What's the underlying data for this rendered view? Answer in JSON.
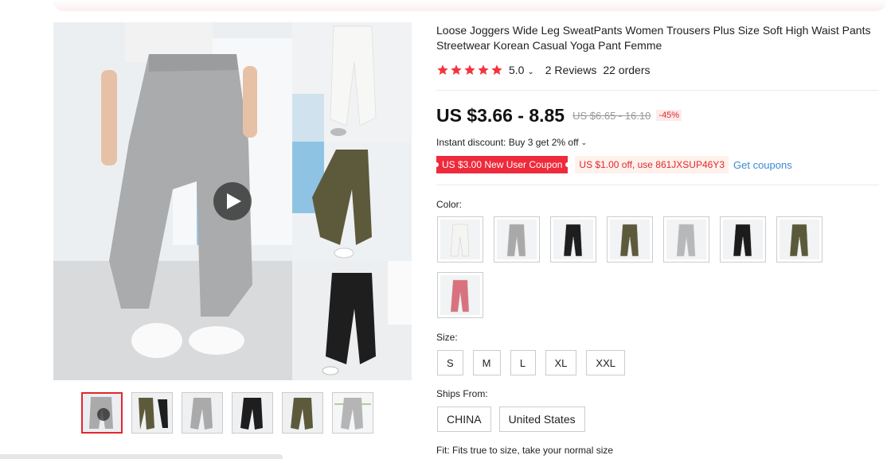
{
  "product": {
    "title": "Loose Joggers Wide Leg SweatPants Women Trousers Plus Size Soft High Waist Pants Streetwear Korean Casual Yoga Pant Femme",
    "rating": "5.0",
    "reviews": "2 Reviews",
    "orders": "22 orders",
    "stars": 5
  },
  "price": {
    "current": "US $3.66 - 8.85",
    "original": "US $6.65 - 16.10",
    "discount": "-45%"
  },
  "promo": {
    "instant_discount": "Instant discount: Buy 3 get 2% off",
    "new_user_coupon": "US $3.00 New User Coupon",
    "code_coupon": "US $1.00 off, use 861JXSUP46Y3",
    "get_coupons": "Get coupons"
  },
  "options": {
    "color_label": "Color:",
    "colors": [
      {
        "color": "#f4f4f2"
      },
      {
        "color": "#a9a9a9"
      },
      {
        "color": "#1e1e1e"
      },
      {
        "color": "#5d5a3c"
      },
      {
        "color": "#b8b8b8"
      },
      {
        "color": "#1c1c1c"
      },
      {
        "color": "#5a5a3a"
      },
      {
        "color": "#d9727e"
      }
    ],
    "size_label": "Size:",
    "sizes": [
      "S",
      "M",
      "L",
      "XL",
      "XXL"
    ],
    "ships_label": "Ships From:",
    "ships": [
      "CHINA",
      "United States"
    ],
    "fit": "Fit: Fits true to size, take your normal size"
  },
  "colors": {
    "accent": "#e0282e",
    "coupon_red": "#ee2a3b",
    "link_blue": "#3a8bd1",
    "star": "#f5333f"
  }
}
